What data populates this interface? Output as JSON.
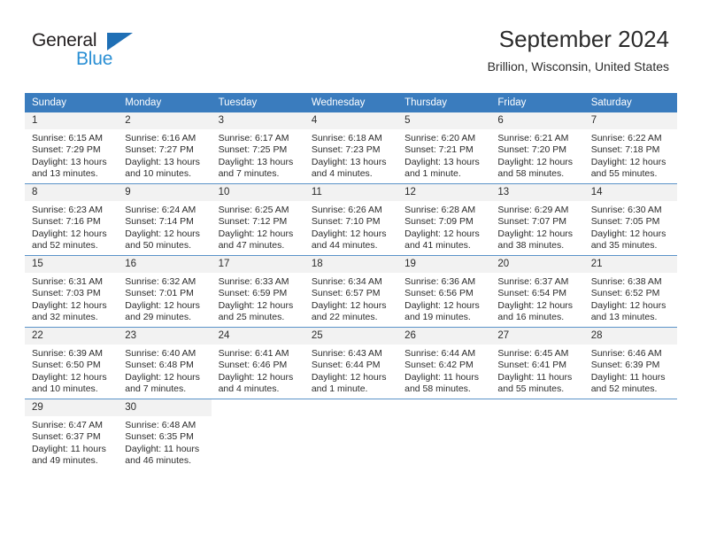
{
  "brand": {
    "name_part1": "General",
    "name_part2": "Blue",
    "triangle_color": "#1f6fb5",
    "blue_color": "#2a8fd4"
  },
  "header": {
    "title": "September 2024",
    "subtitle": "Brillion, Wisconsin, United States",
    "header_bg_color": "#3a7cbe",
    "daynum_bg_color": "#f2f2f2"
  },
  "weekday_headers": [
    "Sunday",
    "Monday",
    "Tuesday",
    "Wednesday",
    "Thursday",
    "Friday",
    "Saturday"
  ],
  "labels": {
    "sunrise_prefix": "Sunrise: ",
    "sunset_prefix": "Sunset: ",
    "daylight_prefix": "Daylight: "
  },
  "weeks": [
    [
      {
        "day": "1",
        "sunrise": "Sunrise: 6:15 AM",
        "sunset": "Sunset: 7:29 PM",
        "daylight1": "Daylight: 13 hours",
        "daylight2": "and 13 minutes."
      },
      {
        "day": "2",
        "sunrise": "Sunrise: 6:16 AM",
        "sunset": "Sunset: 7:27 PM",
        "daylight1": "Daylight: 13 hours",
        "daylight2": "and 10 minutes."
      },
      {
        "day": "3",
        "sunrise": "Sunrise: 6:17 AM",
        "sunset": "Sunset: 7:25 PM",
        "daylight1": "Daylight: 13 hours",
        "daylight2": "and 7 minutes."
      },
      {
        "day": "4",
        "sunrise": "Sunrise: 6:18 AM",
        "sunset": "Sunset: 7:23 PM",
        "daylight1": "Daylight: 13 hours",
        "daylight2": "and 4 minutes."
      },
      {
        "day": "5",
        "sunrise": "Sunrise: 6:20 AM",
        "sunset": "Sunset: 7:21 PM",
        "daylight1": "Daylight: 13 hours",
        "daylight2": "and 1 minute."
      },
      {
        "day": "6",
        "sunrise": "Sunrise: 6:21 AM",
        "sunset": "Sunset: 7:20 PM",
        "daylight1": "Daylight: 12 hours",
        "daylight2": "and 58 minutes."
      },
      {
        "day": "7",
        "sunrise": "Sunrise: 6:22 AM",
        "sunset": "Sunset: 7:18 PM",
        "daylight1": "Daylight: 12 hours",
        "daylight2": "and 55 minutes."
      }
    ],
    [
      {
        "day": "8",
        "sunrise": "Sunrise: 6:23 AM",
        "sunset": "Sunset: 7:16 PM",
        "daylight1": "Daylight: 12 hours",
        "daylight2": "and 52 minutes."
      },
      {
        "day": "9",
        "sunrise": "Sunrise: 6:24 AM",
        "sunset": "Sunset: 7:14 PM",
        "daylight1": "Daylight: 12 hours",
        "daylight2": "and 50 minutes."
      },
      {
        "day": "10",
        "sunrise": "Sunrise: 6:25 AM",
        "sunset": "Sunset: 7:12 PM",
        "daylight1": "Daylight: 12 hours",
        "daylight2": "and 47 minutes."
      },
      {
        "day": "11",
        "sunrise": "Sunrise: 6:26 AM",
        "sunset": "Sunset: 7:10 PM",
        "daylight1": "Daylight: 12 hours",
        "daylight2": "and 44 minutes."
      },
      {
        "day": "12",
        "sunrise": "Sunrise: 6:28 AM",
        "sunset": "Sunset: 7:09 PM",
        "daylight1": "Daylight: 12 hours",
        "daylight2": "and 41 minutes."
      },
      {
        "day": "13",
        "sunrise": "Sunrise: 6:29 AM",
        "sunset": "Sunset: 7:07 PM",
        "daylight1": "Daylight: 12 hours",
        "daylight2": "and 38 minutes."
      },
      {
        "day": "14",
        "sunrise": "Sunrise: 6:30 AM",
        "sunset": "Sunset: 7:05 PM",
        "daylight1": "Daylight: 12 hours",
        "daylight2": "and 35 minutes."
      }
    ],
    [
      {
        "day": "15",
        "sunrise": "Sunrise: 6:31 AM",
        "sunset": "Sunset: 7:03 PM",
        "daylight1": "Daylight: 12 hours",
        "daylight2": "and 32 minutes."
      },
      {
        "day": "16",
        "sunrise": "Sunrise: 6:32 AM",
        "sunset": "Sunset: 7:01 PM",
        "daylight1": "Daylight: 12 hours",
        "daylight2": "and 29 minutes."
      },
      {
        "day": "17",
        "sunrise": "Sunrise: 6:33 AM",
        "sunset": "Sunset: 6:59 PM",
        "daylight1": "Daylight: 12 hours",
        "daylight2": "and 25 minutes."
      },
      {
        "day": "18",
        "sunrise": "Sunrise: 6:34 AM",
        "sunset": "Sunset: 6:57 PM",
        "daylight1": "Daylight: 12 hours",
        "daylight2": "and 22 minutes."
      },
      {
        "day": "19",
        "sunrise": "Sunrise: 6:36 AM",
        "sunset": "Sunset: 6:56 PM",
        "daylight1": "Daylight: 12 hours",
        "daylight2": "and 19 minutes."
      },
      {
        "day": "20",
        "sunrise": "Sunrise: 6:37 AM",
        "sunset": "Sunset: 6:54 PM",
        "daylight1": "Daylight: 12 hours",
        "daylight2": "and 16 minutes."
      },
      {
        "day": "21",
        "sunrise": "Sunrise: 6:38 AM",
        "sunset": "Sunset: 6:52 PM",
        "daylight1": "Daylight: 12 hours",
        "daylight2": "and 13 minutes."
      }
    ],
    [
      {
        "day": "22",
        "sunrise": "Sunrise: 6:39 AM",
        "sunset": "Sunset: 6:50 PM",
        "daylight1": "Daylight: 12 hours",
        "daylight2": "and 10 minutes."
      },
      {
        "day": "23",
        "sunrise": "Sunrise: 6:40 AM",
        "sunset": "Sunset: 6:48 PM",
        "daylight1": "Daylight: 12 hours",
        "daylight2": "and 7 minutes."
      },
      {
        "day": "24",
        "sunrise": "Sunrise: 6:41 AM",
        "sunset": "Sunset: 6:46 PM",
        "daylight1": "Daylight: 12 hours",
        "daylight2": "and 4 minutes."
      },
      {
        "day": "25",
        "sunrise": "Sunrise: 6:43 AM",
        "sunset": "Sunset: 6:44 PM",
        "daylight1": "Daylight: 12 hours",
        "daylight2": "and 1 minute."
      },
      {
        "day": "26",
        "sunrise": "Sunrise: 6:44 AM",
        "sunset": "Sunset: 6:42 PM",
        "daylight1": "Daylight: 11 hours",
        "daylight2": "and 58 minutes."
      },
      {
        "day": "27",
        "sunrise": "Sunrise: 6:45 AM",
        "sunset": "Sunset: 6:41 PM",
        "daylight1": "Daylight: 11 hours",
        "daylight2": "and 55 minutes."
      },
      {
        "day": "28",
        "sunrise": "Sunrise: 6:46 AM",
        "sunset": "Sunset: 6:39 PM",
        "daylight1": "Daylight: 11 hours",
        "daylight2": "and 52 minutes."
      }
    ],
    [
      {
        "day": "29",
        "sunrise": "Sunrise: 6:47 AM",
        "sunset": "Sunset: 6:37 PM",
        "daylight1": "Daylight: 11 hours",
        "daylight2": "and 49 minutes."
      },
      {
        "day": "30",
        "sunrise": "Sunrise: 6:48 AM",
        "sunset": "Sunset: 6:35 PM",
        "daylight1": "Daylight: 11 hours",
        "daylight2": "and 46 minutes."
      },
      {
        "day": "",
        "sunrise": "",
        "sunset": "",
        "daylight1": "",
        "daylight2": ""
      },
      {
        "day": "",
        "sunrise": "",
        "sunset": "",
        "daylight1": "",
        "daylight2": ""
      },
      {
        "day": "",
        "sunrise": "",
        "sunset": "",
        "daylight1": "",
        "daylight2": ""
      },
      {
        "day": "",
        "sunrise": "",
        "sunset": "",
        "daylight1": "",
        "daylight2": ""
      },
      {
        "day": "",
        "sunrise": "",
        "sunset": "",
        "daylight1": "",
        "daylight2": ""
      }
    ]
  ]
}
